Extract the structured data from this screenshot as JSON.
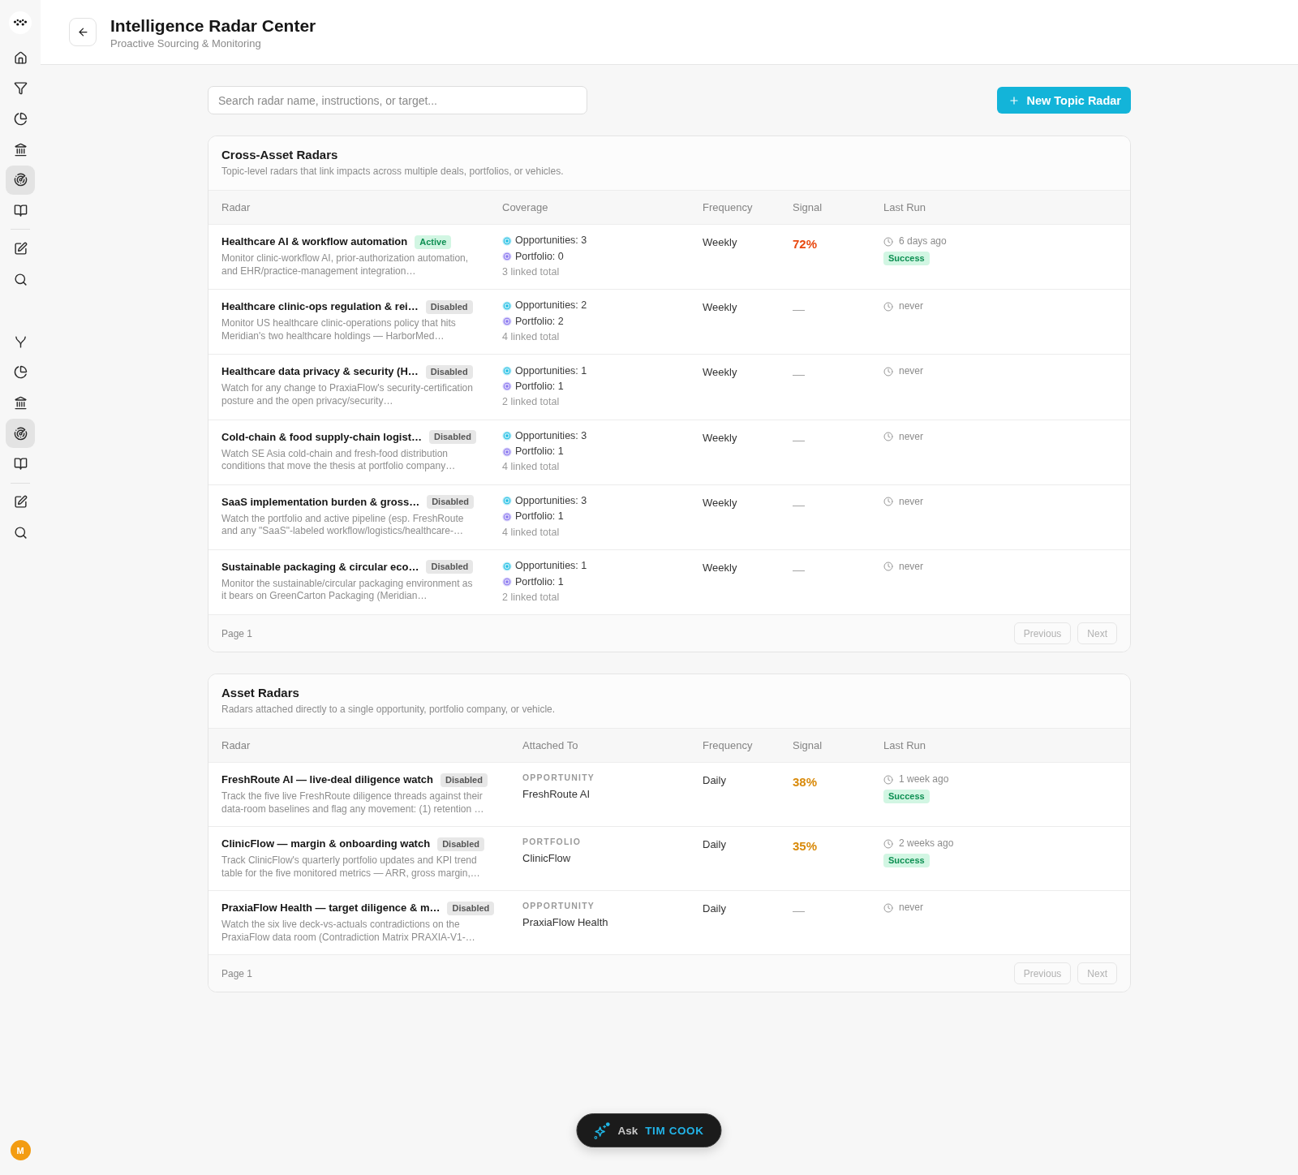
{
  "sidebar": {
    "menus": [
      {
        "sections": [
          {
            "items": [
              {
                "kind": "home",
                "selected": false
              },
              {
                "kind": "filter",
                "selected": false
              },
              {
                "kind": "chart",
                "selected": false
              },
              {
                "kind": "bank",
                "selected": false
              },
              {
                "kind": "radar",
                "selected": true
              },
              {
                "kind": "book",
                "selected": false
              }
            ]
          },
          {
            "items": [
              {
                "kind": "edit",
                "selected": false
              },
              {
                "kind": "search",
                "selected": false
              }
            ]
          }
        ]
      },
      {
        "sections": [
          {
            "items": [
              {
                "kind": "fork",
                "selected": false
              },
              {
                "kind": "chart",
                "selected": false
              },
              {
                "kind": "bank",
                "selected": false
              },
              {
                "kind": "radar",
                "selected": true
              },
              {
                "kind": "book",
                "selected": false
              }
            ]
          },
          {
            "items": [
              {
                "kind": "edit",
                "selected": false
              },
              {
                "kind": "search",
                "selected": false
              }
            ]
          }
        ]
      }
    ],
    "avatar": "M"
  },
  "header": {
    "title": "Intelligence Radar Center",
    "subtitle": "Proactive Sourcing & Monitoring"
  },
  "search": {
    "placeholder": "Search radar name, instructions, or target..."
  },
  "new_button": {
    "label": "New Topic Radar"
  },
  "cross_asset": {
    "title": "Cross-Asset Radars",
    "subtitle": "Topic-level radars that link impacts across multiple deals, portfolios, or vehicles.",
    "columns": [
      "Radar",
      "Coverage",
      "Frequency",
      "Signal",
      "Last Run"
    ],
    "rows": [
      {
        "title": "Healthcare AI & workflow automation",
        "status": {
          "label": "Active",
          "kind": "active"
        },
        "description": "Monitor clinic-workflow AI, prior-authorization automation, and EHR/practice-management integration…",
        "coverage": {
          "opportunities": "Opportunities: 3",
          "portfolio": "Portfolio: 0",
          "total": "3 linked total"
        },
        "frequency": "Weekly",
        "signal": {
          "value": "72%",
          "color": "#e9480f"
        },
        "last_run": {
          "time": "6 days ago",
          "result": {
            "label": "Success",
            "kind": "success"
          }
        }
      },
      {
        "title": "Healthcare clinic-ops regulation & rei…",
        "status": {
          "label": "Disabled",
          "kind": "disabled"
        },
        "description": "Monitor US healthcare clinic-operations policy that hits Meridian's two healthcare holdings — HarborMed…",
        "coverage": {
          "opportunities": "Opportunities: 2",
          "portfolio": "Portfolio: 2",
          "total": "4 linked total"
        },
        "frequency": "Weekly",
        "signal": {
          "value": "—"
        },
        "last_run": {
          "time": "never"
        }
      },
      {
        "title": "Healthcare data privacy & security (H…",
        "status": {
          "label": "Disabled",
          "kind": "disabled"
        },
        "description": "Watch for any change to PraxiaFlow's security-certification posture and the open privacy/security…",
        "coverage": {
          "opportunities": "Opportunities: 1",
          "portfolio": "Portfolio: 1",
          "total": "2 linked total"
        },
        "frequency": "Weekly",
        "signal": {
          "value": "—"
        },
        "last_run": {
          "time": "never"
        }
      },
      {
        "title": "Cold-chain & food supply-chain logist…",
        "status": {
          "label": "Disabled",
          "kind": "disabled"
        },
        "description": "Watch SE Asia cold-chain and fresh-food distribution conditions that move the thesis at portfolio company…",
        "coverage": {
          "opportunities": "Opportunities: 3",
          "portfolio": "Portfolio: 1",
          "total": "4 linked total"
        },
        "frequency": "Weekly",
        "signal": {
          "value": "—"
        },
        "last_run": {
          "time": "never"
        }
      },
      {
        "title": "SaaS implementation burden & gross…",
        "status": {
          "label": "Disabled",
          "kind": "disabled"
        },
        "description": "Watch the portfolio and active pipeline (esp. FreshRoute and any \"SaaS\"-labeled workflow/logistics/healthcare-…",
        "coverage": {
          "opportunities": "Opportunities: 3",
          "portfolio": "Portfolio: 1",
          "total": "4 linked total"
        },
        "frequency": "Weekly",
        "signal": {
          "value": "—"
        },
        "last_run": {
          "time": "never"
        }
      },
      {
        "title": "Sustainable packaging & circular eco…",
        "status": {
          "label": "Disabled",
          "kind": "disabled"
        },
        "description": "Monitor the sustainable/circular packaging environment as it bears on GreenCarton Packaging (Meridian…",
        "coverage": {
          "opportunities": "Opportunities: 1",
          "portfolio": "Portfolio: 1",
          "total": "2 linked total"
        },
        "frequency": "Weekly",
        "signal": {
          "value": "—"
        },
        "last_run": {
          "time": "never"
        }
      }
    ],
    "page": "Page 1",
    "pagination": [
      {
        "label": "Previous",
        "disabled": true
      },
      {
        "label": "Next",
        "disabled": true
      }
    ]
  },
  "asset": {
    "title": "Asset Radars",
    "subtitle": "Radars attached directly to a single opportunity, portfolio company, or vehicle.",
    "columns": [
      "Radar",
      "Attached To",
      "Frequency",
      "Signal",
      "Last Run"
    ],
    "rows": [
      {
        "title": "FreshRoute AI — live-deal diligence watch",
        "status": {
          "label": "Disabled",
          "kind": "disabled"
        },
        "description": "Track the five live FreshRoute diligence threads against their data-room baselines and flag any movement: (1) retention …",
        "attached": {
          "type": "OPPORTUNITY",
          "name": "FreshRoute AI"
        },
        "frequency": "Daily",
        "signal": {
          "value": "38%",
          "color": "#d98a0a"
        },
        "last_run": {
          "time": "1 week ago",
          "result": {
            "label": "Success",
            "kind": "success"
          }
        }
      },
      {
        "title": "ClinicFlow — margin & onboarding watch",
        "status": {
          "label": "Disabled",
          "kind": "disabled"
        },
        "description": "Track ClinicFlow's quarterly portfolio updates and KPI trend table for the five monitored metrics — ARR, gross margin,…",
        "attached": {
          "type": "PORTFOLIO",
          "name": "ClinicFlow"
        },
        "frequency": "Daily",
        "signal": {
          "value": "35%",
          "color": "#d98a0a"
        },
        "last_run": {
          "time": "2 weeks ago",
          "result": {
            "label": "Success",
            "kind": "success"
          }
        }
      },
      {
        "title": "PraxiaFlow Health — target diligence & m…",
        "status": {
          "label": "Disabled",
          "kind": "disabled"
        },
        "description": "Watch the six live deck-vs-actuals contradictions on the PraxiaFlow data room (Contradiction Matrix PRAXIA-V1-…",
        "attached": {
          "type": "OPPORTUNITY",
          "name": "PraxiaFlow Health"
        },
        "frequency": "Daily",
        "signal": {
          "value": "—"
        },
        "last_run": {
          "time": "never"
        }
      }
    ],
    "page": "Page 1",
    "pagination": [
      {
        "label": "Previous",
        "disabled": true
      },
      {
        "label": "Next",
        "disabled": true
      }
    ]
  },
  "assistant": {
    "prefix": "Ask",
    "name": "TIM COOK"
  }
}
